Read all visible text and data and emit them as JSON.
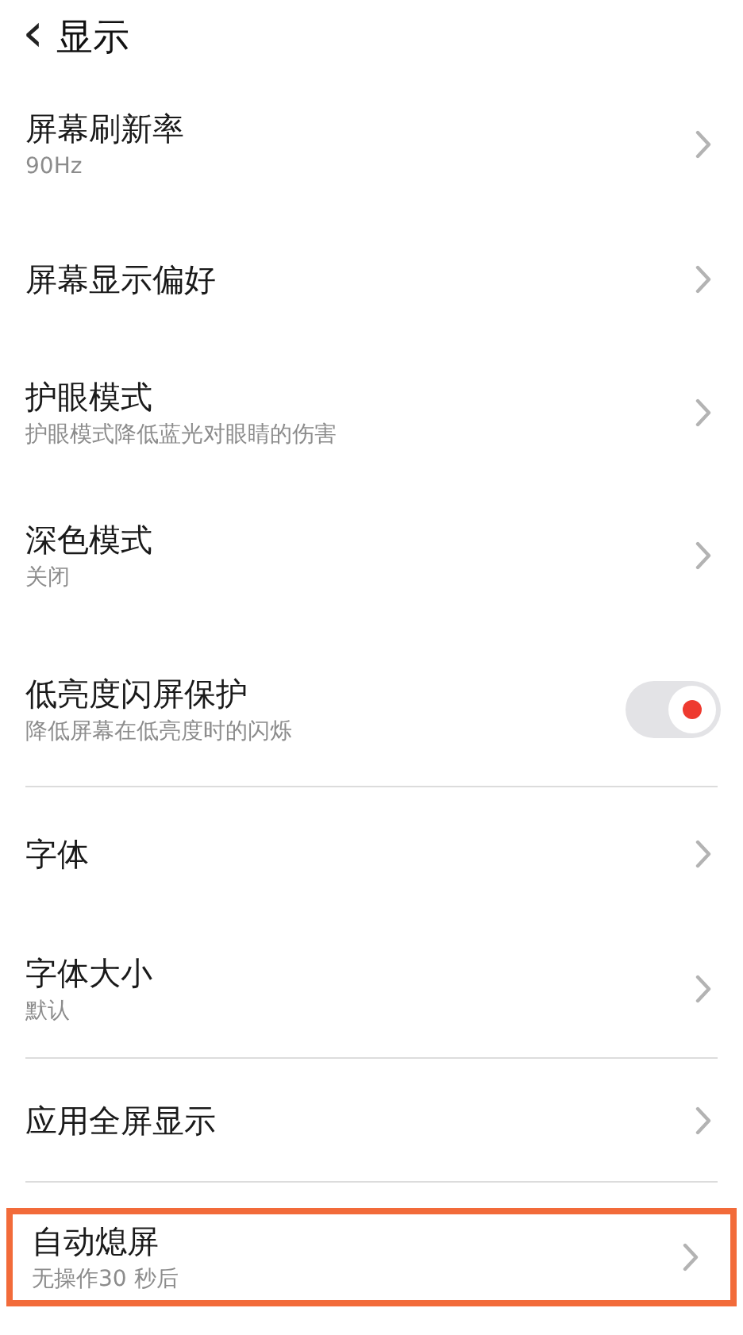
{
  "header": {
    "back": "‹",
    "title": "显示"
  },
  "sections": [
    [
      {
        "kind": "nav",
        "title": "屏幕刷新率",
        "subtitle": "90Hz"
      },
      {
        "kind": "nav",
        "title": "屏幕显示偏好"
      },
      {
        "kind": "nav",
        "title": "护眼模式",
        "subtitle": "护眼模式降低蓝光对眼睛的伤害"
      },
      {
        "kind": "nav",
        "title": "深色模式",
        "subtitle": "关闭"
      },
      {
        "kind": "toggle",
        "title": "低亮度闪屏保护",
        "subtitle": "降低屏幕在低亮度时的闪烁",
        "on": true
      }
    ],
    [
      {
        "kind": "nav",
        "title": "字体"
      },
      {
        "kind": "nav",
        "title": "字体大小",
        "subtitle": "默认"
      }
    ],
    [
      {
        "kind": "nav",
        "title": "应用全屏显示"
      }
    ],
    [
      {
        "kind": "nav",
        "title": "自动熄屏",
        "subtitle": "无操作30 秒后",
        "highlighted": true
      }
    ]
  ]
}
